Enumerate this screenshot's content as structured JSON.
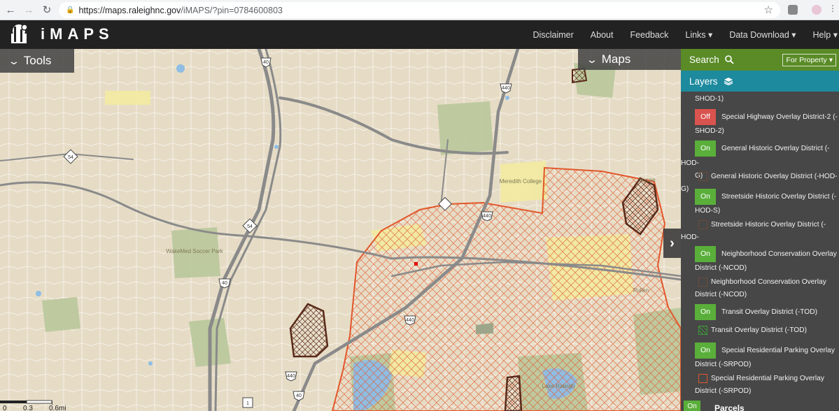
{
  "browser": {
    "url_domain": "https://maps.raleighnc.gov",
    "url_path": "/iMAPS/?pin=0784600803"
  },
  "header": {
    "title": "iMAPS",
    "nav": [
      "Disclaimer",
      "About",
      "Feedback",
      "Links ▾",
      "Data Download ▾",
      "Help ▾"
    ]
  },
  "map": {
    "tools_label": "Tools",
    "maps_label": "Maps",
    "scale_labels": [
      "0",
      "0.3",
      "0.6mi"
    ],
    "place_labels": [
      "Meredith College",
      "WakeMed Soccer Park",
      "Pullen",
      "Lake Raleigh",
      "Jaycee"
    ],
    "shields": [
      "40",
      "440",
      "54",
      "54",
      "40",
      "440",
      "440",
      "440",
      "40",
      "1"
    ]
  },
  "panel": {
    "search_label": "Search",
    "search_mode": "For Property ▾",
    "layers_label": "Layers",
    "cut_text": "SHOD-1)",
    "layers": [
      {
        "state": "Off",
        "line1": "Special Highway Overlay District-2 (-",
        "line2": "SHOD-2)"
      },
      {
        "state": "On",
        "line1": "General Historic Overlay District (-HOD-",
        "line2": "G)"
      },
      {
        "state": "On",
        "line1": "Streetside Historic Overlay District (-",
        "line2": "HOD-S)"
      },
      {
        "state": "On",
        "line1": "Neighborhood Conservation Overlay",
        "line2": "District (-NCOD)"
      },
      {
        "state": "On",
        "line1": "Transit Overlay District (-TOD)",
        "line2": ""
      },
      {
        "state": "On",
        "line1": "Special Residential Parking Overlay",
        "line2": "District (-SRPOD)"
      }
    ],
    "legends": [
      {
        "line1": "General Historic Overlay District (-HOD-G)",
        "line2": ""
      },
      {
        "line1": "Streetside Historic Overlay District (-HOD-",
        "line2": "S)"
      },
      {
        "line1": "Neighborhood Conservation Overlay",
        "line2": "District (-NCOD)"
      },
      {
        "line1": "Transit Overlay District (-TOD)",
        "line2": ""
      },
      {
        "line1": "Special Residential Parking Overlay",
        "line2": "District (-SRPOD)"
      }
    ],
    "parcels": {
      "state": "On",
      "label": "Parcels"
    }
  },
  "colors": {
    "header_bg": "#222222",
    "search_green": "#5a8b27",
    "layers_teal": "#1d8a9e",
    "toggle_on": "#5aaf3b",
    "toggle_off": "#d9534f",
    "overlay_orange": "#e2572b",
    "historic_brown": "#5a2a1a"
  }
}
